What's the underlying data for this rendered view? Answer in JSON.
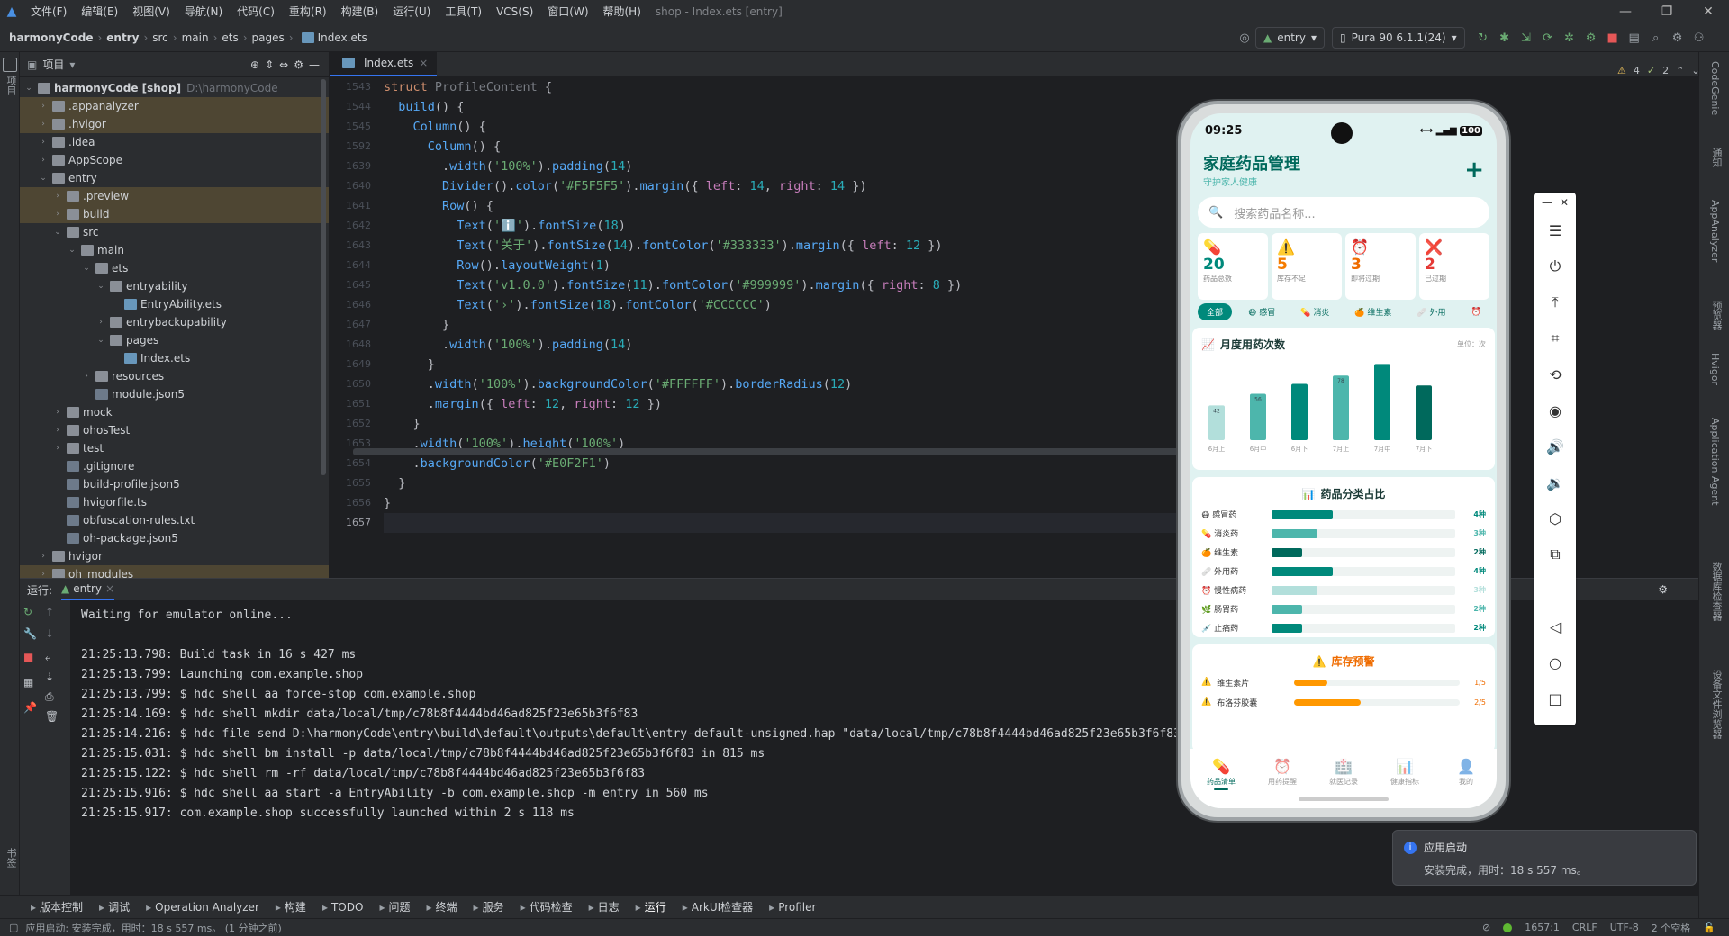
{
  "menubar": {
    "items": [
      "文件(F)",
      "编辑(E)",
      "视图(V)",
      "导航(N)",
      "代码(C)",
      "重构(R)",
      "构建(B)",
      "运行(U)",
      "工具(T)",
      "VCS(S)",
      "窗口(W)",
      "帮助(H)"
    ],
    "title": "shop - Index.ets [entry]"
  },
  "navbar": {
    "breadcrumb": [
      "harmonyCode",
      "entry",
      "src",
      "main",
      "ets",
      "pages",
      "Index.ets"
    ],
    "module_combo": "entry",
    "device_combo": "Pura 90 6.1.1(24)"
  },
  "leftstrip": {
    "project": "项目",
    "bookmarks": "书签",
    "structure": "结构"
  },
  "project": {
    "header": "项目",
    "tree": [
      {
        "label": "harmonyCode [shop]",
        "extra": "D:\\harmonyCode",
        "depth": 0,
        "open": true,
        "type": "root"
      },
      {
        "label": ".appanalyzer",
        "depth": 1,
        "open": false,
        "type": "folder",
        "sel": true
      },
      {
        "label": ".hvigor",
        "depth": 1,
        "open": false,
        "type": "folder",
        "sel": true
      },
      {
        "label": ".idea",
        "depth": 1,
        "open": false,
        "type": "folder"
      },
      {
        "label": "AppScope",
        "depth": 1,
        "open": false,
        "type": "folder"
      },
      {
        "label": "entry",
        "depth": 1,
        "open": true,
        "type": "folder"
      },
      {
        "label": ".preview",
        "depth": 2,
        "open": false,
        "type": "folder",
        "sel": true
      },
      {
        "label": "build",
        "depth": 2,
        "open": false,
        "type": "folder",
        "sel": true
      },
      {
        "label": "src",
        "depth": 2,
        "open": true,
        "type": "folder"
      },
      {
        "label": "main",
        "depth": 3,
        "open": true,
        "type": "folder"
      },
      {
        "label": "ets",
        "depth": 4,
        "open": true,
        "type": "folder"
      },
      {
        "label": "entryability",
        "depth": 5,
        "open": true,
        "type": "folder"
      },
      {
        "label": "EntryAbility.ets",
        "depth": 6,
        "type": "ets"
      },
      {
        "label": "entrybackupability",
        "depth": 5,
        "open": false,
        "type": "folder"
      },
      {
        "label": "pages",
        "depth": 5,
        "open": true,
        "type": "folder"
      },
      {
        "label": "Index.ets",
        "depth": 6,
        "type": "ets"
      },
      {
        "label": "resources",
        "depth": 4,
        "open": false,
        "type": "folder"
      },
      {
        "label": "module.json5",
        "depth": 4,
        "type": "file"
      },
      {
        "label": "mock",
        "depth": 2,
        "open": false,
        "type": "folder"
      },
      {
        "label": "ohosTest",
        "depth": 2,
        "open": false,
        "type": "folder"
      },
      {
        "label": "test",
        "depth": 2,
        "open": false,
        "type": "folder"
      },
      {
        "label": ".gitignore",
        "depth": 2,
        "type": "file"
      },
      {
        "label": "build-profile.json5",
        "depth": 2,
        "type": "file"
      },
      {
        "label": "hvigorfile.ts",
        "depth": 2,
        "type": "file"
      },
      {
        "label": "obfuscation-rules.txt",
        "depth": 2,
        "type": "file"
      },
      {
        "label": "oh-package.json5",
        "depth": 2,
        "type": "file"
      },
      {
        "label": "hvigor",
        "depth": 1,
        "open": false,
        "type": "folder"
      },
      {
        "label": "oh_modules",
        "depth": 1,
        "open": false,
        "type": "folder",
        "sel": true
      }
    ]
  },
  "editor": {
    "tab": "Index.ets",
    "warnings": "4",
    "weak_warnings": "2",
    "lines": [
      {
        "n": "1543",
        "html": "<span class='kw'>struct</span> <span class='cm'>ProfileContent</span> {"
      },
      {
        "n": "1544",
        "html": "  <span class='fn'>build</span>() {"
      },
      {
        "n": "1545",
        "html": "    <span class='fn'>Column</span>() {"
      },
      {
        "n": "1592",
        "html": "      <span class='fn'>Column</span>() {"
      },
      {
        "n": "1639",
        "html": "        .<span class='fn'>width</span>(<span class='st'>'100%'</span>).<span class='fn'>padding</span>(<span class='nm'>14</span>)"
      },
      {
        "n": "1640",
        "html": "        <span class='fn'>Divider</span>().<span class='fn'>color</span>(<span class='st'>'#F5F5F5'</span>).<span class='fn'>margin</span>({ <span class='pr'>left</span>: <span class='nm'>14</span>, <span class='pr'>right</span>: <span class='nm'>14</span> })"
      },
      {
        "n": "1641",
        "html": "        <span class='fn'>Row</span>() {"
      },
      {
        "n": "1642",
        "html": "          <span class='fn'>Text</span>(<span class='st'>'ℹ️'</span>).<span class='fn'>fontSize</span>(<span class='nm'>18</span>)"
      },
      {
        "n": "1643",
        "html": "          <span class='fn'>Text</span>(<span class='st'>'关于'</span>).<span class='fn'>fontSize</span>(<span class='nm'>14</span>).<span class='fn'>fontColor</span>(<span class='st'>'#333333'</span>).<span class='fn'>margin</span>({ <span class='pr'>left</span>: <span class='nm'>12</span> })"
      },
      {
        "n": "1644",
        "html": "          <span class='fn'>Row</span>().<span class='fn'>layoutWeight</span>(<span class='nm'>1</span>)"
      },
      {
        "n": "1645",
        "html": "          <span class='fn'>Text</span>(<span class='st'>'v1.0.0'</span>).<span class='fn'>fontSize</span>(<span class='nm'>11</span>).<span class='fn'>fontColor</span>(<span class='st'>'#999999'</span>).<span class='fn'>margin</span>({ <span class='pr'>right</span>: <span class='nm'>8</span> })"
      },
      {
        "n": "1646",
        "html": "          <span class='fn'>Text</span>(<span class='st'>'›'</span>).<span class='fn'>fontSize</span>(<span class='nm'>18</span>).<span class='fn'>fontColor</span>(<span class='st'>'#CCCCCC'</span>)"
      },
      {
        "n": "1647",
        "html": "        }"
      },
      {
        "n": "1648",
        "html": "        .<span class='fn'>width</span>(<span class='st'>'100%'</span>).<span class='fn'>padding</span>(<span class='nm'>14</span>)"
      },
      {
        "n": "1649",
        "html": "      }"
      },
      {
        "n": "1650",
        "html": "      .<span class='fn'>width</span>(<span class='st'>'100%'</span>).<span class='fn'>backgroundColor</span>(<span class='st'>'#FFFFFF'</span>).<span class='fn'>borderRadius</span>(<span class='nm'>12</span>)"
      },
      {
        "n": "1651",
        "html": "      .<span class='fn'>margin</span>({ <span class='pr'>left</span>: <span class='nm'>12</span>, <span class='pr'>right</span>: <span class='nm'>12</span> })"
      },
      {
        "n": "1652",
        "html": "    }"
      },
      {
        "n": "1653",
        "html": "    .<span class='fn'>width</span>(<span class='st'>'100%'</span>).<span class='fn'>height</span>(<span class='st'>'100%'</span>)"
      },
      {
        "n": "1654",
        "html": "    .<span class='fn'>backgroundColor</span>(<span class='st'>'#E0F2F1'</span>)"
      },
      {
        "n": "1655",
        "html": "  }"
      },
      {
        "n": "1656",
        "html": "}"
      },
      {
        "n": "1657",
        "html": ""
      }
    ]
  },
  "run": {
    "label": "运行:",
    "tab": "entry",
    "lines": [
      "Waiting for emulator online...",
      "",
      "21:25:13.798: Build task in 16 s 427 ms",
      "21:25:13.799: Launching com.example.shop",
      "21:25:13.799: $ hdc shell aa force-stop com.example.shop",
      "21:25:14.169: $ hdc shell mkdir data/local/tmp/c78b8f4444bd46ad825f23e65b3f6f83",
      "21:25:14.216: $ hdc file send D:\\harmonyCode\\entry\\build\\default\\outputs\\default\\entry-default-unsigned.hap \"data/local/tmp/c78b8f4444bd46ad825f23e65b3f6f83\" in 815 ms",
      "21:25:15.031: $ hdc shell bm install -p data/local/tmp/c78b8f4444bd46ad825f23e65b3f6f83 in 815 ms",
      "21:25:15.122: $ hdc shell rm -rf data/local/tmp/c78b8f4444bd46ad825f23e65b3f6f83",
      "21:25:15.916: $ hdc shell aa start -a EntryAbility -b com.example.shop -m entry in 560 ms",
      "21:25:15.917: com.example.shop successfully launched within 2 s 118 ms"
    ]
  },
  "rightstrip": [
    "CodeGenie",
    "通知",
    "AppAnalyzer",
    "预览器",
    "Hvigor",
    "Application Agent",
    "数据库检查器",
    "设备文件浏览器"
  ],
  "bottombar": [
    "版本控制",
    "调试",
    "Operation Analyzer",
    "构建",
    "TODO",
    "问题",
    "终端",
    "服务",
    "代码检查",
    "日志",
    "运行",
    "ArkUI检查器",
    "Profiler"
  ],
  "statusbar": {
    "message": "应用启动: 安装完成，用时：18 s 557 ms。 (1 分钟之前)",
    "position": "1657:1",
    "line_ending": "CRLF",
    "encoding": "UTF-8",
    "indent": "2 个空格"
  },
  "phone": {
    "time": "09:25",
    "battery": "100",
    "title": "家庭药品管理",
    "subtitle": "守护家人健康",
    "search_placeholder": "搜索药品名称...",
    "stats": [
      {
        "icon": "💊",
        "value": "20",
        "label": "药品总数",
        "color": "#00897b"
      },
      {
        "icon": "⚠️",
        "value": "5",
        "label": "库存不足",
        "color": "#f57c00"
      },
      {
        "icon": "⏰",
        "value": "3",
        "label": "即将过期",
        "color": "#ef6c00"
      },
      {
        "icon": "❌",
        "value": "2",
        "label": "已过期",
        "color": "#e53935"
      }
    ],
    "chips": [
      "全部",
      "😷 感冒",
      "💊 消炎",
      "🍊 维生素",
      "🩹 外用",
      "⏰"
    ],
    "monthly": {
      "title": "月度用药次数",
      "unit": "单位：次",
      "categories": [
        "6月上",
        "6月中",
        "6月下",
        "7月上",
        "7月中",
        "7月下"
      ],
      "values": [
        42,
        56,
        68,
        78,
        92,
        66
      ],
      "labels": [
        "42",
        "56",
        "",
        "78",
        "",
        ""
      ],
      "colors": [
        "#b2dfdb",
        "#4db6ac",
        "#00897b",
        "#4db6ac",
        "#00897b",
        "#00695c"
      ]
    },
    "category": {
      "title": "药品分类占比",
      "items": [
        {
          "icon": "😷",
          "name": "感冒药",
          "value": 4,
          "label": "4种",
          "color": "#00897b"
        },
        {
          "icon": "💊",
          "name": "消炎药",
          "value": 3,
          "label": "3种",
          "color": "#4db6ac"
        },
        {
          "icon": "🍊",
          "name": "维生素",
          "value": 2,
          "label": "2种",
          "color": "#00695c"
        },
        {
          "icon": "🩹",
          "name": "外用药",
          "value": 4,
          "label": "4种",
          "color": "#00897b"
        },
        {
          "icon": "⏰",
          "name": "慢性病药",
          "value": 3,
          "label": "3种",
          "color": "#b2dfdb"
        },
        {
          "icon": "🌿",
          "name": "肠胃药",
          "value": 2,
          "label": "2种",
          "color": "#4db6ac"
        },
        {
          "icon": "💉",
          "name": "止痛药",
          "value": 2,
          "label": "2种",
          "color": "#00897b"
        }
      ],
      "max": 12
    },
    "warning": {
      "title": "库存预警",
      "items": [
        {
          "name": "维生素片",
          "value": 1,
          "max": 5,
          "label": "1/5"
        },
        {
          "name": "布洛芬胶囊",
          "value": 2,
          "max": 5,
          "label": "2/5"
        }
      ]
    },
    "nav": [
      {
        "icon": "💊",
        "label": "药品清单",
        "on": true
      },
      {
        "icon": "⏰",
        "label": "用药提醒",
        "on": false
      },
      {
        "icon": "🏥",
        "label": "就医记录",
        "on": false
      },
      {
        "icon": "📊",
        "label": "健康指标",
        "on": false
      },
      {
        "icon": "👤",
        "label": "我的",
        "on": false
      }
    ]
  },
  "notification": {
    "title": "应用启动",
    "body": "安装完成，用时：18 s 557 ms。"
  }
}
